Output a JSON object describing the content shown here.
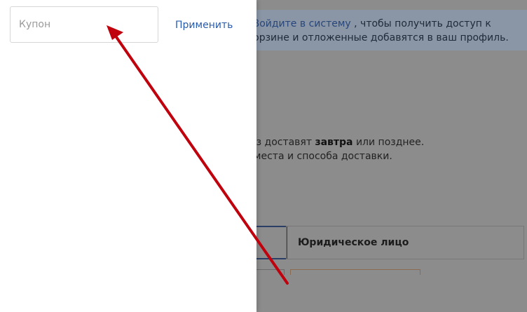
{
  "background": {
    "notice_line1_prefix": "",
    "notice_line1_link": "Войдите в систему",
    "notice_line1_suffix": ", чтобы получить доступ к",
    "notice_line2": "в корзине и отложенные добавятся в ваш профиль.",
    "delivery_line1_prefix": "аказ доставят ",
    "delivery_line1_bold": "завтра",
    "delivery_line1_suffix": " или позднее.",
    "delivery_line2": "ра места и способа доставки.",
    "legal_entity_tab": "Юридическое лицо"
  },
  "coupon": {
    "input_value": "",
    "input_placeholder": "Купон",
    "apply_label": "Применить"
  },
  "colors": {
    "accent_link": "#2a5bab",
    "arrow": "#c0000d",
    "overlay": "#8c8c8c"
  }
}
